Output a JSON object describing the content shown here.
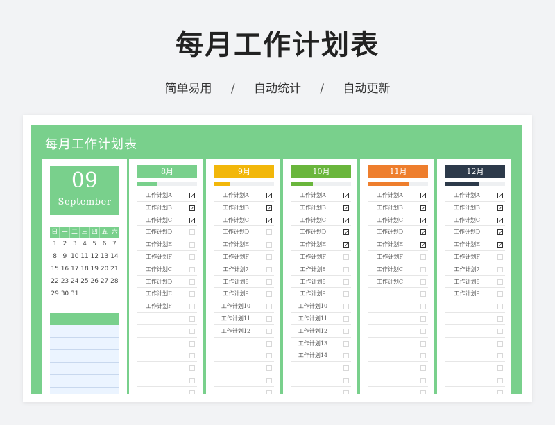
{
  "header": {
    "title": "每月工作计划表",
    "features": [
      "简单易用",
      "自动统计",
      "自动更新"
    ],
    "separator": "/"
  },
  "sheet": {
    "title": "每月工作计划表",
    "accent": "#79d08c",
    "date": {
      "day": "09",
      "month": "September"
    },
    "calendar": {
      "weekdays": [
        "日",
        "一",
        "二",
        "三",
        "四",
        "五",
        "六"
      ],
      "weeks": [
        [
          "1",
          "2",
          "3",
          "4",
          "5",
          "6",
          "7"
        ],
        [
          "8",
          "9",
          "10",
          "11",
          "12",
          "13",
          "14"
        ],
        [
          "15",
          "16",
          "17",
          "18",
          "19",
          "20",
          "21"
        ],
        [
          "22",
          "23",
          "24",
          "25",
          "26",
          "27",
          "28"
        ],
        [
          "29",
          "30",
          "31",
          "",
          "",
          "",
          ""
        ]
      ]
    },
    "months": [
      {
        "label": "8月",
        "color": "#79d08c",
        "progress": 0.33,
        "tasks": [
          {
            "label": "工作计划A",
            "done": true
          },
          {
            "label": "工作计划B",
            "done": true
          },
          {
            "label": "工作计划C",
            "done": true
          },
          {
            "label": "工作计划D",
            "done": false
          },
          {
            "label": "工作计划E",
            "done": false
          },
          {
            "label": "工作计划F",
            "done": false
          },
          {
            "label": "工作计划C",
            "done": false
          },
          {
            "label": "工作计划D",
            "done": false
          },
          {
            "label": "工作计划E",
            "done": false
          },
          {
            "label": "工作计划F",
            "done": false
          },
          {
            "label": "",
            "done": false
          },
          {
            "label": "",
            "done": false
          },
          {
            "label": "",
            "done": false
          },
          {
            "label": "",
            "done": false
          },
          {
            "label": "",
            "done": false
          },
          {
            "label": "",
            "done": false
          },
          {
            "label": "",
            "done": false
          }
        ]
      },
      {
        "label": "9月",
        "color": "#f2b70a",
        "progress": 0.25,
        "tasks": [
          {
            "label": "工作计划A",
            "done": true
          },
          {
            "label": "工作计划B",
            "done": true
          },
          {
            "label": "工作计划C",
            "done": true
          },
          {
            "label": "工作计划D",
            "done": false
          },
          {
            "label": "工作计划E",
            "done": false
          },
          {
            "label": "工作计划F",
            "done": false
          },
          {
            "label": "工作计划7",
            "done": false
          },
          {
            "label": "工作计划8",
            "done": false
          },
          {
            "label": "工作计划9",
            "done": false
          },
          {
            "label": "工作计划10",
            "done": false
          },
          {
            "label": "工作计划11",
            "done": false
          },
          {
            "label": "工作计划12",
            "done": false
          },
          {
            "label": "",
            "done": false
          },
          {
            "label": "",
            "done": false
          },
          {
            "label": "",
            "done": false
          },
          {
            "label": "",
            "done": false
          },
          {
            "label": "",
            "done": false
          }
        ]
      },
      {
        "label": "10月",
        "color": "#6ab63c",
        "progress": 0.36,
        "tasks": [
          {
            "label": "工作计划A",
            "done": true
          },
          {
            "label": "工作计划B",
            "done": true
          },
          {
            "label": "工作计划C",
            "done": true
          },
          {
            "label": "工作计划D",
            "done": true
          },
          {
            "label": "工作计划E",
            "done": true
          },
          {
            "label": "工作计划F",
            "done": false
          },
          {
            "label": "工作计划8",
            "done": false
          },
          {
            "label": "工作计划8",
            "done": false
          },
          {
            "label": "工作计划9",
            "done": false
          },
          {
            "label": "工作计划10",
            "done": false
          },
          {
            "label": "工作计划11",
            "done": false
          },
          {
            "label": "工作计划12",
            "done": false
          },
          {
            "label": "工作计划13",
            "done": false
          },
          {
            "label": "工作计划14",
            "done": false
          },
          {
            "label": "",
            "done": false
          },
          {
            "label": "",
            "done": false
          },
          {
            "label": "",
            "done": false
          }
        ]
      },
      {
        "label": "11月",
        "color": "#ee7e2d",
        "progress": 0.67,
        "tasks": [
          {
            "label": "工作计划A",
            "done": true
          },
          {
            "label": "工作计划B",
            "done": true
          },
          {
            "label": "工作计划C",
            "done": true
          },
          {
            "label": "工作计划D",
            "done": true
          },
          {
            "label": "工作计划E",
            "done": true
          },
          {
            "label": "工作计划F",
            "done": false
          },
          {
            "label": "工作计划C",
            "done": false
          },
          {
            "label": "工作计划C",
            "done": false
          },
          {
            "label": "",
            "done": false
          },
          {
            "label": "",
            "done": false
          },
          {
            "label": "",
            "done": false
          },
          {
            "label": "",
            "done": false
          },
          {
            "label": "",
            "done": false
          },
          {
            "label": "",
            "done": false
          },
          {
            "label": "",
            "done": false
          },
          {
            "label": "",
            "done": false
          },
          {
            "label": "",
            "done": false
          }
        ]
      },
      {
        "label": "12月",
        "color": "#2d3a4a",
        "progress": 0.56,
        "tasks": [
          {
            "label": "工作计划A",
            "done": true
          },
          {
            "label": "工作计划B",
            "done": true
          },
          {
            "label": "工作计划C",
            "done": true
          },
          {
            "label": "工作计划D",
            "done": true
          },
          {
            "label": "工作计划E",
            "done": true
          },
          {
            "label": "工作计划F",
            "done": false
          },
          {
            "label": "工作计划7",
            "done": false
          },
          {
            "label": "工作计划8",
            "done": false
          },
          {
            "label": "工作计划9",
            "done": false
          },
          {
            "label": "",
            "done": false
          },
          {
            "label": "",
            "done": false
          },
          {
            "label": "",
            "done": false
          },
          {
            "label": "",
            "done": false
          },
          {
            "label": "",
            "done": false
          },
          {
            "label": "",
            "done": false
          },
          {
            "label": "",
            "done": false
          },
          {
            "label": "",
            "done": false
          }
        ]
      }
    ]
  }
}
